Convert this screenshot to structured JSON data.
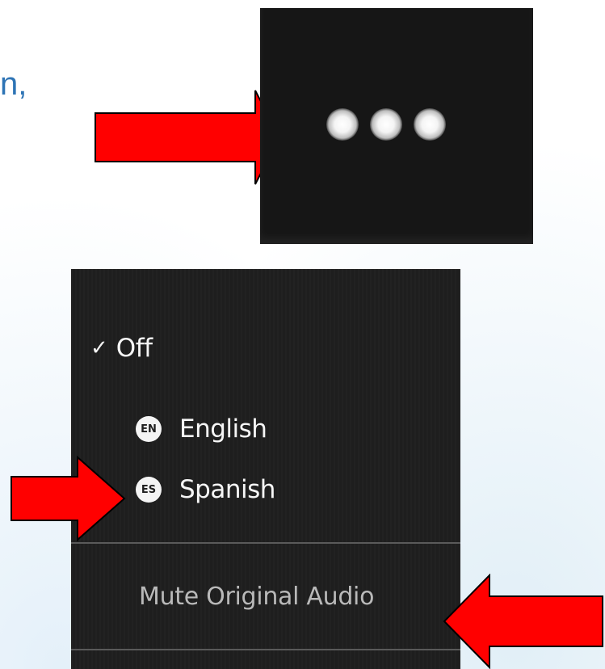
{
  "slide": {
    "partial_text": "n,"
  },
  "more_button": {
    "icon": "more-options-icon"
  },
  "menu": {
    "items": [
      {
        "label": "Off",
        "checked": true
      },
      {
        "label": "English",
        "badge": "EN"
      },
      {
        "label": "Spanish",
        "badge": "ES"
      }
    ],
    "mute_label": "Mute Original Audio"
  },
  "colors": {
    "arrow_fill": "#ff0000",
    "menu_bg": "#1e1e1e",
    "slide_text": "#2e74b5"
  }
}
